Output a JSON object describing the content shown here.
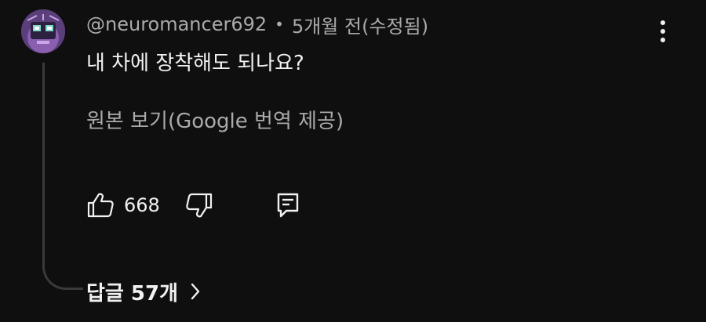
{
  "comment": {
    "author": "@neuromancer692",
    "separator": "•",
    "time": "5개월 전(수정됨)",
    "text": "내 차에 장착해도 되나요?",
    "translate_link": "원본 보기(Google 번역 제공)",
    "like_count": "668",
    "replies_label": "답글 57개"
  },
  "icons": {
    "menu": "more-vertical-icon",
    "like": "thumbs-up-icon",
    "dislike": "thumbs-down-icon",
    "reply": "comment-reply-icon",
    "replies_chevron": "chevron-right-icon"
  },
  "colors": {
    "background": "#0f0f0f",
    "text_primary": "#f1f1f1",
    "text_secondary": "#aaaaaa",
    "thread_line": "#3a3a3a"
  }
}
